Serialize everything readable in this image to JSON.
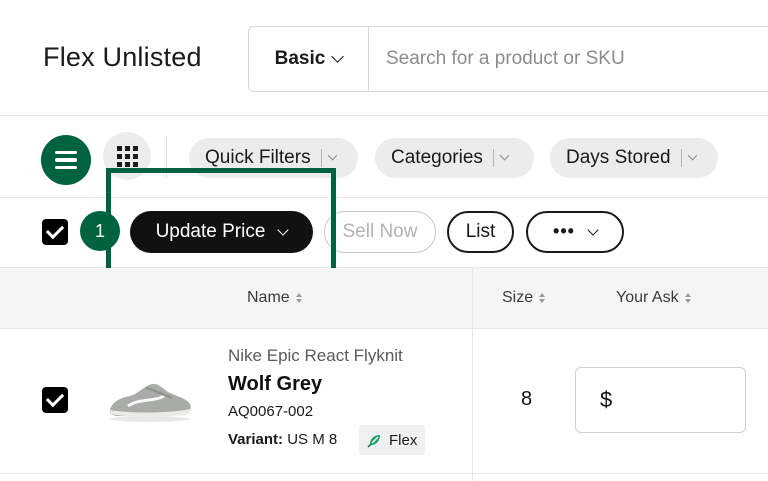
{
  "header": {
    "title": "Flex Unlisted",
    "search": {
      "scope": "Basic",
      "placeholder": "Search for a product or SKU",
      "value": ""
    }
  },
  "toolbar": {
    "view_options": [
      "list-view",
      "grid-view"
    ],
    "active_view": "list-view",
    "filters": [
      {
        "label": "Quick Filters"
      },
      {
        "label": "Categories"
      },
      {
        "label": "Days Stored"
      }
    ]
  },
  "bulk_actions": {
    "select_all_checked": true,
    "selected_count": "1",
    "primary_label": "Update Price",
    "sell_now_label": "Sell Now",
    "list_label": "List",
    "more_label": "•••"
  },
  "table": {
    "columns": [
      {
        "label": "Name"
      },
      {
        "label": "Size"
      },
      {
        "label": "Your Ask"
      }
    ],
    "rows": [
      {
        "checked": true,
        "product_name": "Nike Epic React Flyknit",
        "colorway": "Wolf Grey",
        "sku": "AQ0067-002",
        "variant_label": "Variant:",
        "variant_value": " US M 8",
        "program_tag": "Flex",
        "size": "8",
        "ask_currency": "$",
        "ask_value": ""
      }
    ]
  },
  "colors": {
    "brand_green": "#006340",
    "primary_button": "#111111",
    "pill_bg": "#ececec"
  },
  "icons": {
    "list_view": "list-icon",
    "grid_view": "grid-icon",
    "flex_tag": "flex-icon",
    "chevron": "chevron-down-icon",
    "sort": "sort-icon"
  }
}
